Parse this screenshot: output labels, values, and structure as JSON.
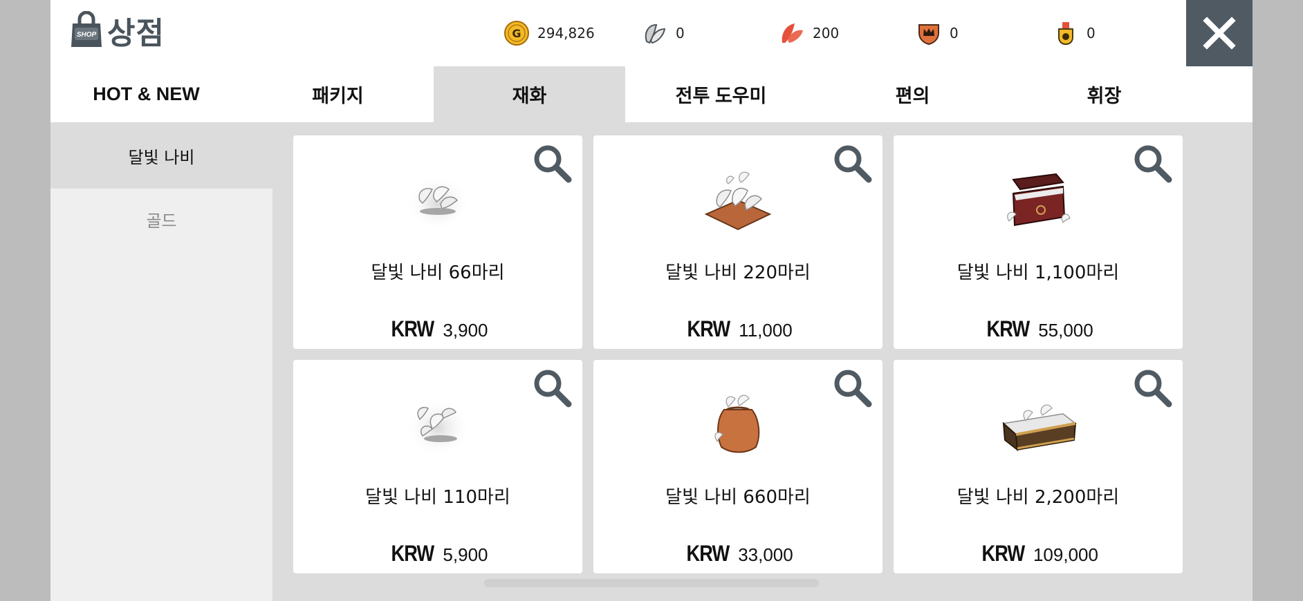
{
  "header": {
    "title": "상점",
    "bag_label": "SHOP",
    "currencies": [
      {
        "icon": "gold-coin-icon",
        "value": "294,826"
      },
      {
        "icon": "moonlight-butterfly-icon",
        "value": "0"
      },
      {
        "icon": "red-feather-icon",
        "value": "200"
      },
      {
        "icon": "crown-shield-icon",
        "value": "0"
      },
      {
        "icon": "medal-icon",
        "value": "0"
      }
    ],
    "close_icon": "close-icon"
  },
  "tabs": [
    {
      "label": "HOT & NEW",
      "active": false
    },
    {
      "label": "패키지",
      "active": false
    },
    {
      "label": "재화",
      "active": true
    },
    {
      "label": "전투 도우미",
      "active": false
    },
    {
      "label": "편의",
      "active": false
    },
    {
      "label": "휘장",
      "active": false
    }
  ],
  "submenu": [
    {
      "label": "달빛 나비",
      "active": true
    },
    {
      "label": "골드",
      "active": false
    }
  ],
  "products": [
    {
      "name": "달빛 나비 66마리",
      "currency": "KRW",
      "price": "3,900",
      "icon": "butterfly-pile-icon"
    },
    {
      "name": "달빛 나비 220마리",
      "currency": "KRW",
      "price": "11,000",
      "icon": "butterfly-cushion-icon"
    },
    {
      "name": "달빛 나비 1,100마리",
      "currency": "KRW",
      "price": "55,000",
      "icon": "butterfly-chest-icon"
    },
    {
      "name": "달빛 나비 110마리",
      "currency": "KRW",
      "price": "5,900",
      "icon": "butterfly-cluster-icon"
    },
    {
      "name": "달빛 나비 660마리",
      "currency": "KRW",
      "price": "33,000",
      "icon": "butterfly-sack-icon"
    },
    {
      "name": "달빛 나비 2,200마리",
      "currency": "KRW",
      "price": "109,000",
      "icon": "butterfly-treasure-icon"
    }
  ],
  "colors": {
    "header_dark": "#4f5a63",
    "panel_bg": "#dcdcdc",
    "submenu_bg": "#efefef",
    "gold": "#f2b928",
    "red_feather": "#e5503c",
    "crown_orange": "#e0713a"
  }
}
